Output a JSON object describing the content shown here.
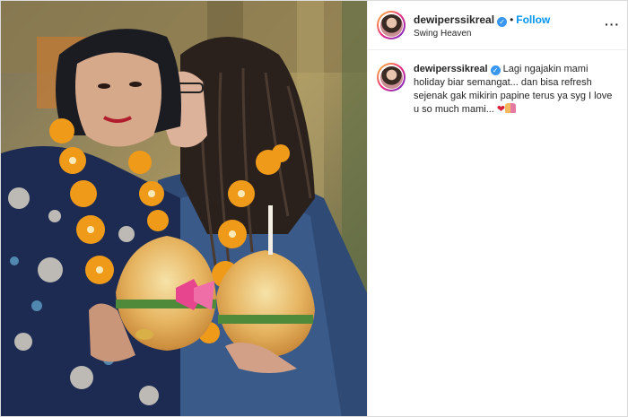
{
  "post": {
    "username": "dewiperssikreal",
    "verified_symbol": "✓",
    "separator": "•",
    "follow_label": "Follow",
    "location": "Swing Heaven",
    "more_label": "···"
  },
  "caption": {
    "username": "dewiperssikreal",
    "text": "Lagi ngajakin mami holiday biar semangat... dan bisa refresh sejenak gak mikirin papine terus ya syg I love u so much mami...",
    "emoji_heart": "❤"
  },
  "colors": {
    "follow": "#0095f6",
    "verified": "#3897f0",
    "border": "#dbdbdb"
  },
  "icons": [
    "verified-badge-icon",
    "more-options-icon",
    "heart-emoji-icon",
    "family-emoji-icon"
  ]
}
